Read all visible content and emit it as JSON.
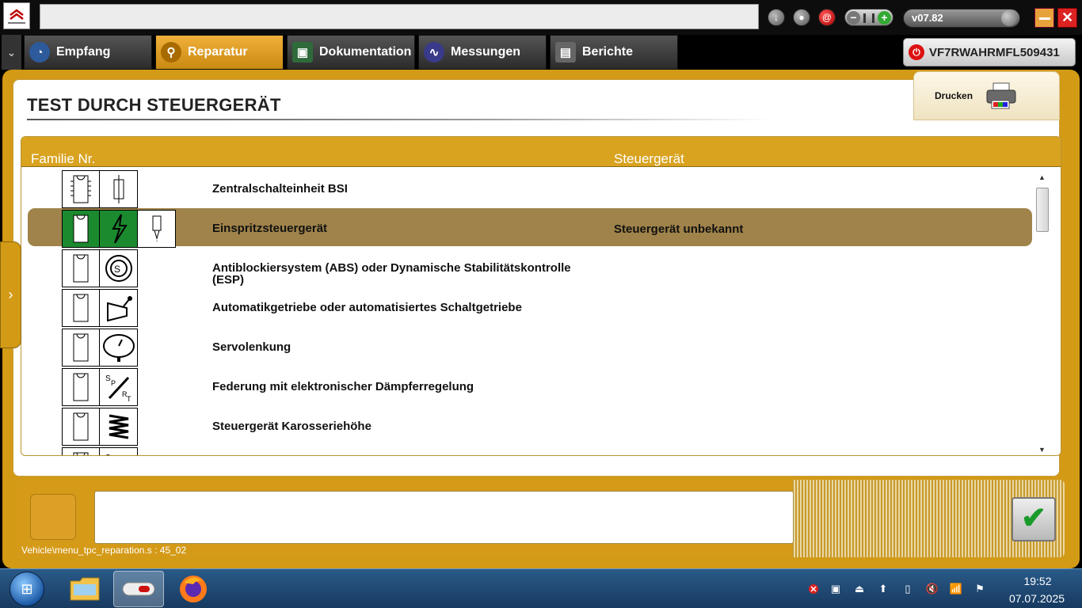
{
  "window": {
    "version": "v07.82",
    "vin": "VF7RWAHRMFL509431",
    "address_value": ""
  },
  "tabs": [
    {
      "label": "Empfang",
      "icon": "globe-icon"
    },
    {
      "label": "Reparatur",
      "icon": "magnifier-icon",
      "active": true
    },
    {
      "label": "Dokumentation",
      "icon": "book-icon"
    },
    {
      "label": "Messungen",
      "icon": "waveform-icon"
    },
    {
      "label": "Berichte",
      "icon": "report-icon"
    }
  ],
  "page": {
    "title": "TEST DURCH STEUERGERÄT",
    "print_label": "Drucken"
  },
  "table": {
    "headers": {
      "family": "Familie Nr.",
      "ecu": "Steuergerät"
    },
    "rows": [
      {
        "label": "Zentralschalteinheit BSI",
        "status": "",
        "icons": [
          "ecu-chip-icon",
          "fuse-icon"
        ],
        "selected": false
      },
      {
        "label": "Einspritzsteuergerät",
        "status": "Steuergerät unbekannt",
        "icons": [
          "ecu-chip-icon",
          "lightning-icon",
          "injector-icon"
        ],
        "selected": true
      },
      {
        "label": "Antiblockiersystem (ABS) oder Dynamische Stabilitätskontrolle (ESP)",
        "status": "",
        "icons": [
          "ecu-chip-icon",
          "abs-icon"
        ],
        "selected": false
      },
      {
        "label": "Automatikgetriebe oder automatisiertes Schaltgetriebe",
        "status": "",
        "icons": [
          "ecu-chip-icon",
          "gearbox-icon"
        ],
        "selected": false
      },
      {
        "label": "Servolenkung",
        "status": "",
        "icons": [
          "ecu-chip-icon",
          "steering-icon"
        ],
        "selected": false
      },
      {
        "label": "Federung mit elektronischer Dämpferregelung",
        "status": "",
        "icons": [
          "ecu-chip-icon",
          "damper-icon"
        ],
        "selected": false
      },
      {
        "label": "Steuergerät Karosseriehöhe",
        "status": "",
        "icons": [
          "ecu-chip-icon",
          "spring-icon"
        ],
        "selected": false
      },
      {
        "label": "",
        "status": "",
        "icons": [
          "ecu-chip-icon",
          "damper-icon"
        ],
        "selected": false
      }
    ]
  },
  "footer": {
    "message": "",
    "path": "Vehicle\\menu_tpc_reparation.s : 45_02"
  },
  "taskbar": {
    "time": "19:52",
    "date": "07.07.2025"
  },
  "colors": {
    "accent": "#d39a16",
    "selected_row": "#a0834a",
    "active_tab": "#e9a32a",
    "ecu_green": "#1b8a2f"
  }
}
